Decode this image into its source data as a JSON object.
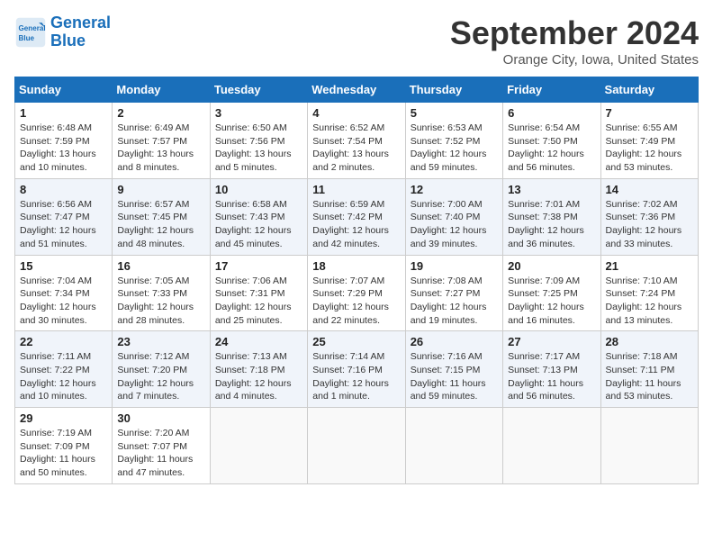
{
  "header": {
    "logo_line1": "General",
    "logo_line2": "Blue",
    "title": "September 2024",
    "location": "Orange City, Iowa, United States"
  },
  "weekdays": [
    "Sunday",
    "Monday",
    "Tuesday",
    "Wednesday",
    "Thursday",
    "Friday",
    "Saturday"
  ],
  "weeks": [
    [
      {
        "day": "1",
        "detail": "Sunrise: 6:48 AM\nSunset: 7:59 PM\nDaylight: 13 hours and 10 minutes."
      },
      {
        "day": "2",
        "detail": "Sunrise: 6:49 AM\nSunset: 7:57 PM\nDaylight: 13 hours and 8 minutes."
      },
      {
        "day": "3",
        "detail": "Sunrise: 6:50 AM\nSunset: 7:56 PM\nDaylight: 13 hours and 5 minutes."
      },
      {
        "day": "4",
        "detail": "Sunrise: 6:52 AM\nSunset: 7:54 PM\nDaylight: 13 hours and 2 minutes."
      },
      {
        "day": "5",
        "detail": "Sunrise: 6:53 AM\nSunset: 7:52 PM\nDaylight: 12 hours and 59 minutes."
      },
      {
        "day": "6",
        "detail": "Sunrise: 6:54 AM\nSunset: 7:50 PM\nDaylight: 12 hours and 56 minutes."
      },
      {
        "day": "7",
        "detail": "Sunrise: 6:55 AM\nSunset: 7:49 PM\nDaylight: 12 hours and 53 minutes."
      }
    ],
    [
      {
        "day": "8",
        "detail": "Sunrise: 6:56 AM\nSunset: 7:47 PM\nDaylight: 12 hours and 51 minutes."
      },
      {
        "day": "9",
        "detail": "Sunrise: 6:57 AM\nSunset: 7:45 PM\nDaylight: 12 hours and 48 minutes."
      },
      {
        "day": "10",
        "detail": "Sunrise: 6:58 AM\nSunset: 7:43 PM\nDaylight: 12 hours and 45 minutes."
      },
      {
        "day": "11",
        "detail": "Sunrise: 6:59 AM\nSunset: 7:42 PM\nDaylight: 12 hours and 42 minutes."
      },
      {
        "day": "12",
        "detail": "Sunrise: 7:00 AM\nSunset: 7:40 PM\nDaylight: 12 hours and 39 minutes."
      },
      {
        "day": "13",
        "detail": "Sunrise: 7:01 AM\nSunset: 7:38 PM\nDaylight: 12 hours and 36 minutes."
      },
      {
        "day": "14",
        "detail": "Sunrise: 7:02 AM\nSunset: 7:36 PM\nDaylight: 12 hours and 33 minutes."
      }
    ],
    [
      {
        "day": "15",
        "detail": "Sunrise: 7:04 AM\nSunset: 7:34 PM\nDaylight: 12 hours and 30 minutes."
      },
      {
        "day": "16",
        "detail": "Sunrise: 7:05 AM\nSunset: 7:33 PM\nDaylight: 12 hours and 28 minutes."
      },
      {
        "day": "17",
        "detail": "Sunrise: 7:06 AM\nSunset: 7:31 PM\nDaylight: 12 hours and 25 minutes."
      },
      {
        "day": "18",
        "detail": "Sunrise: 7:07 AM\nSunset: 7:29 PM\nDaylight: 12 hours and 22 minutes."
      },
      {
        "day": "19",
        "detail": "Sunrise: 7:08 AM\nSunset: 7:27 PM\nDaylight: 12 hours and 19 minutes."
      },
      {
        "day": "20",
        "detail": "Sunrise: 7:09 AM\nSunset: 7:25 PM\nDaylight: 12 hours and 16 minutes."
      },
      {
        "day": "21",
        "detail": "Sunrise: 7:10 AM\nSunset: 7:24 PM\nDaylight: 12 hours and 13 minutes."
      }
    ],
    [
      {
        "day": "22",
        "detail": "Sunrise: 7:11 AM\nSunset: 7:22 PM\nDaylight: 12 hours and 10 minutes."
      },
      {
        "day": "23",
        "detail": "Sunrise: 7:12 AM\nSunset: 7:20 PM\nDaylight: 12 hours and 7 minutes."
      },
      {
        "day": "24",
        "detail": "Sunrise: 7:13 AM\nSunset: 7:18 PM\nDaylight: 12 hours and 4 minutes."
      },
      {
        "day": "25",
        "detail": "Sunrise: 7:14 AM\nSunset: 7:16 PM\nDaylight: 12 hours and 1 minute."
      },
      {
        "day": "26",
        "detail": "Sunrise: 7:16 AM\nSunset: 7:15 PM\nDaylight: 11 hours and 59 minutes."
      },
      {
        "day": "27",
        "detail": "Sunrise: 7:17 AM\nSunset: 7:13 PM\nDaylight: 11 hours and 56 minutes."
      },
      {
        "day": "28",
        "detail": "Sunrise: 7:18 AM\nSunset: 7:11 PM\nDaylight: 11 hours and 53 minutes."
      }
    ],
    [
      {
        "day": "29",
        "detail": "Sunrise: 7:19 AM\nSunset: 7:09 PM\nDaylight: 11 hours and 50 minutes."
      },
      {
        "day": "30",
        "detail": "Sunrise: 7:20 AM\nSunset: 7:07 PM\nDaylight: 11 hours and 47 minutes."
      },
      {
        "day": "",
        "detail": ""
      },
      {
        "day": "",
        "detail": ""
      },
      {
        "day": "",
        "detail": ""
      },
      {
        "day": "",
        "detail": ""
      },
      {
        "day": "",
        "detail": ""
      }
    ]
  ]
}
